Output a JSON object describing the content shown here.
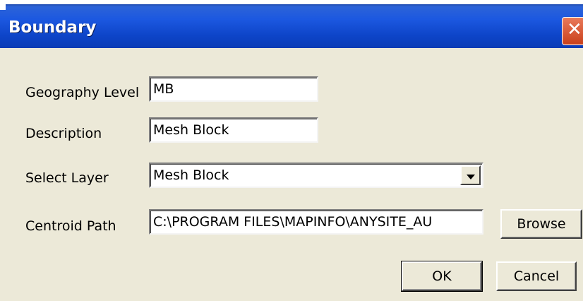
{
  "window": {
    "title": "Boundary"
  },
  "labels": {
    "geography_level": "Geography Level",
    "description": "Description",
    "select_layer": "Select Layer",
    "centroid_path": "Centroid Path"
  },
  "fields": {
    "geography_level": "MB",
    "description": "Mesh Block",
    "select_layer": "Mesh Block",
    "centroid_path": "C:\\PROGRAM FILES\\MAPINFO\\ANYSITE_AU"
  },
  "buttons": {
    "browse": "Browse",
    "ok": "OK",
    "cancel": "Cancel"
  },
  "icons": {
    "close": "close-icon",
    "dropdown": "chevron-down-icon"
  }
}
